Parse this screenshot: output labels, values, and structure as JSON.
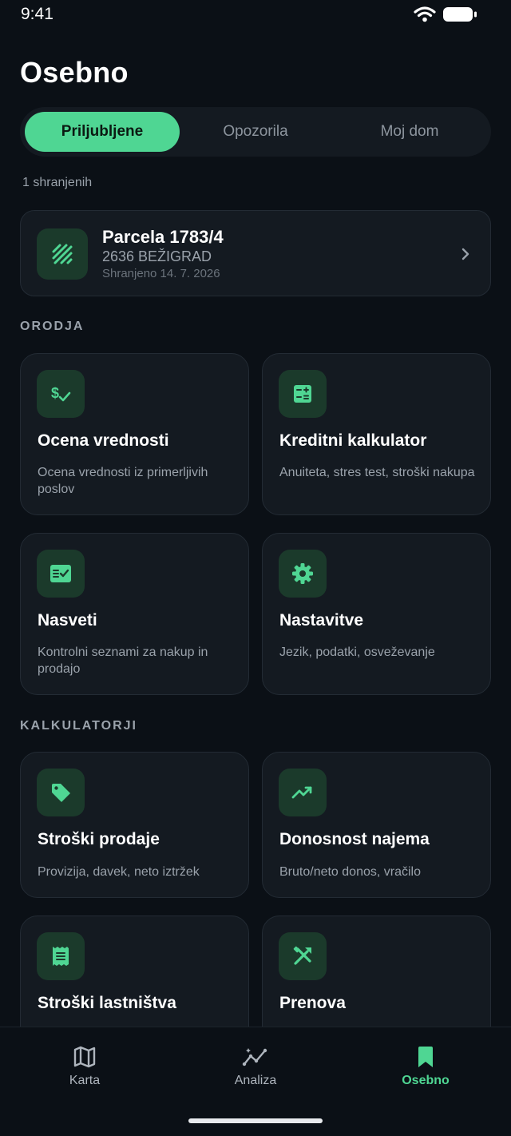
{
  "status": {
    "time": "9:41"
  },
  "page": {
    "title": "Osebno"
  },
  "tabs": [
    {
      "label": "Priljubljene",
      "active": true
    },
    {
      "label": "Opozorila",
      "active": false
    },
    {
      "label": "Moj dom",
      "active": false
    }
  ],
  "saved": {
    "count_label": "1 shranjenih",
    "item": {
      "title": "Parcela 1783/4",
      "subtitle": "2636 BEŽIGRAD",
      "date": "Shranjeno 14. 7. 2026",
      "icon": "parcel-hatch-icon"
    }
  },
  "sections": {
    "tools_label": "ORODJA",
    "calculators_label": "KALKULATORJI"
  },
  "tools": [
    {
      "title": "Ocena vrednosti",
      "desc": "Ocena vrednosti iz primerljivih poslov",
      "icon": "price-check-icon"
    },
    {
      "title": "Kreditni kalkulator",
      "desc": "Anuiteta, stres test, stroški nakupa",
      "icon": "calculator-icon"
    },
    {
      "title": "Nasveti",
      "desc": "Kontrolni seznami za nakup in prodajo",
      "icon": "checklist-icon"
    },
    {
      "title": "Nastavitve",
      "desc": "Jezik, podatki, osveževanje",
      "icon": "gear-icon"
    }
  ],
  "calculators": [
    {
      "title": "Stroški prodaje",
      "desc": "Provizija, davek, neto iztržek",
      "icon": "tag-icon"
    },
    {
      "title": "Donosnost najema",
      "desc": "Bruto/neto donos, vračilo",
      "icon": "trending-up-icon"
    },
    {
      "title": "Stroški lastništva",
      "desc": "",
      "icon": "receipt-icon"
    },
    {
      "title": "Prenova",
      "desc": "",
      "icon": "tools-icon"
    }
  ],
  "nav": [
    {
      "label": "Karta",
      "icon": "map-icon",
      "active": false
    },
    {
      "label": "Analiza",
      "icon": "analytics-icon",
      "active": false
    },
    {
      "label": "Osebno",
      "icon": "bookmark-icon",
      "active": true
    }
  ],
  "colors": {
    "accent": "#4fd693",
    "background": "#0b1016",
    "card": "#141a21",
    "icon_bg": "#1b3a2b"
  }
}
